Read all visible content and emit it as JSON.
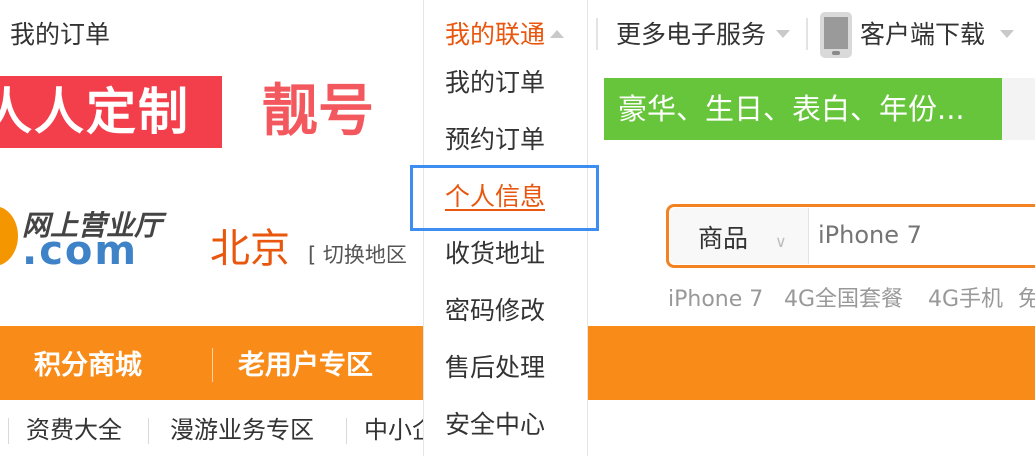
{
  "topbar": {
    "my_orders": "我的订单",
    "my_unicom": "我的联通",
    "more_services": "更多电子服务",
    "client_download": "客户端下载"
  },
  "dropdown": {
    "items": [
      "我的订单",
      "预约订单",
      "个人信息",
      "收货地址",
      "密码修改",
      "售后处理",
      "安全中心"
    ],
    "active_index": 2
  },
  "banner": {
    "promo1": "人人定制",
    "promo2": "靓号",
    "promo3": "豪华、生日、表白、年份..."
  },
  "logo": {
    "cn": "网上营业厅",
    "com": ".com"
  },
  "location": {
    "city": "北京",
    "switch": "[ 切换地区"
  },
  "search": {
    "category": "商品",
    "placeholder": "iPhone 7",
    "hot": [
      "iPhone 7",
      "4G全国套餐",
      "4G手机",
      "免"
    ]
  },
  "nav": {
    "items": [
      "积分商城",
      "老用户专区"
    ]
  },
  "subnav": {
    "items": [
      "资费大全",
      "漫游业务专区",
      "中小企"
    ]
  },
  "colors": {
    "accent_orange": "#f98b18",
    "active_text": "#e9560d",
    "highlight_blue": "#3d8ef0",
    "promo_green": "#67c53b",
    "promo_red": "#f33f4c"
  }
}
